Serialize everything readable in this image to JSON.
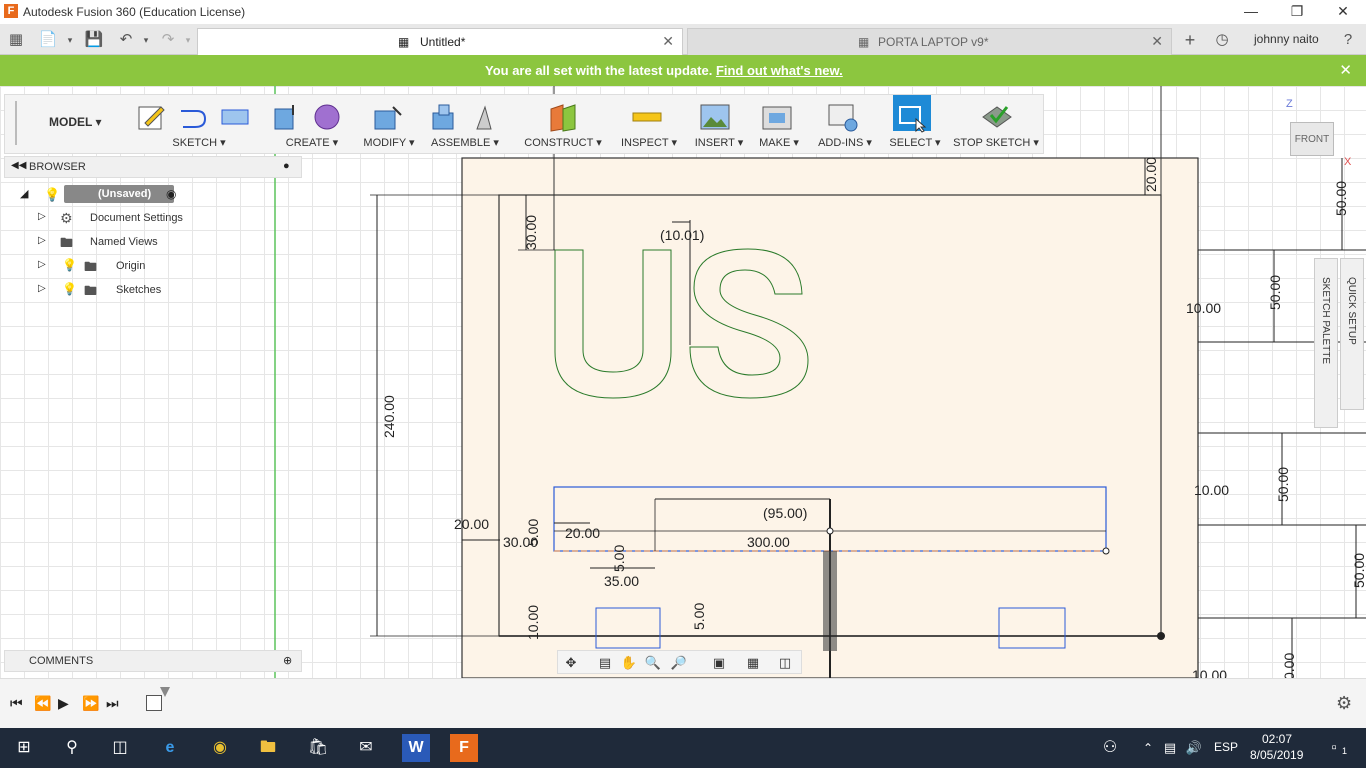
{
  "window": {
    "title": "Autodesk Fusion 360 (Education License)",
    "minimize": "—",
    "maximize": "❐",
    "close": "✕"
  },
  "tabs": [
    {
      "label": "Untitled*",
      "active": true
    },
    {
      "label": "PORTA LAPTOP v9*",
      "active": false
    }
  ],
  "user": {
    "name": "johnny naito"
  },
  "banner": {
    "message": "You are all set with the latest update.",
    "link": "Find out what's new.",
    "close": "✕"
  },
  "toolbar": {
    "workspace": "MODEL",
    "groups": [
      "SKETCH",
      "CREATE",
      "MODIFY",
      "ASSEMBLE",
      "CONSTRUCT",
      "INSPECT",
      "INSERT",
      "MAKE",
      "ADD-INS",
      "SELECT",
      "STOP SKETCH"
    ]
  },
  "browser": {
    "header": "BROWSER",
    "root": "(Unsaved)",
    "items": [
      "Document Settings",
      "Named Views",
      "Origin",
      "Sketches"
    ]
  },
  "comments": {
    "header": "COMMENTS"
  },
  "viewcube": {
    "face": "FRONT",
    "x_axis": "X",
    "z_axis": "Z"
  },
  "side_palettes": [
    "SKETCH PALETTE",
    "QUICK SETUP"
  ],
  "sketch": {
    "text": "US",
    "dimensions": {
      "d_20_top": "20.00",
      "d_30": "30.00",
      "d_1001": "(10.01)",
      "d_240": "240.00",
      "d_20_left": "20.00",
      "d_95": "(95.00)",
      "d_300": "300.00",
      "d_35": "35.00",
      "d_5a": "5.00",
      "d_30b": "30.00",
      "d_20b": "20.00",
      "d_10_low": "10.00",
      "d_5_low": "5.00",
      "d_5c": "5.00",
      "d_50_r1": "50.00",
      "d_10_r1": "10.00",
      "d_50_r2": "50.00",
      "d_10_r2": "10.00",
      "d_50_r3": "50.00",
      "d_50_r4": "50.00",
      "d_00_r": "0.00",
      "d_1000_r": "10.00"
    }
  },
  "taskbar": {
    "language": "ESP",
    "time": "02:07",
    "date": "8/05/2019",
    "notifications": "1"
  }
}
